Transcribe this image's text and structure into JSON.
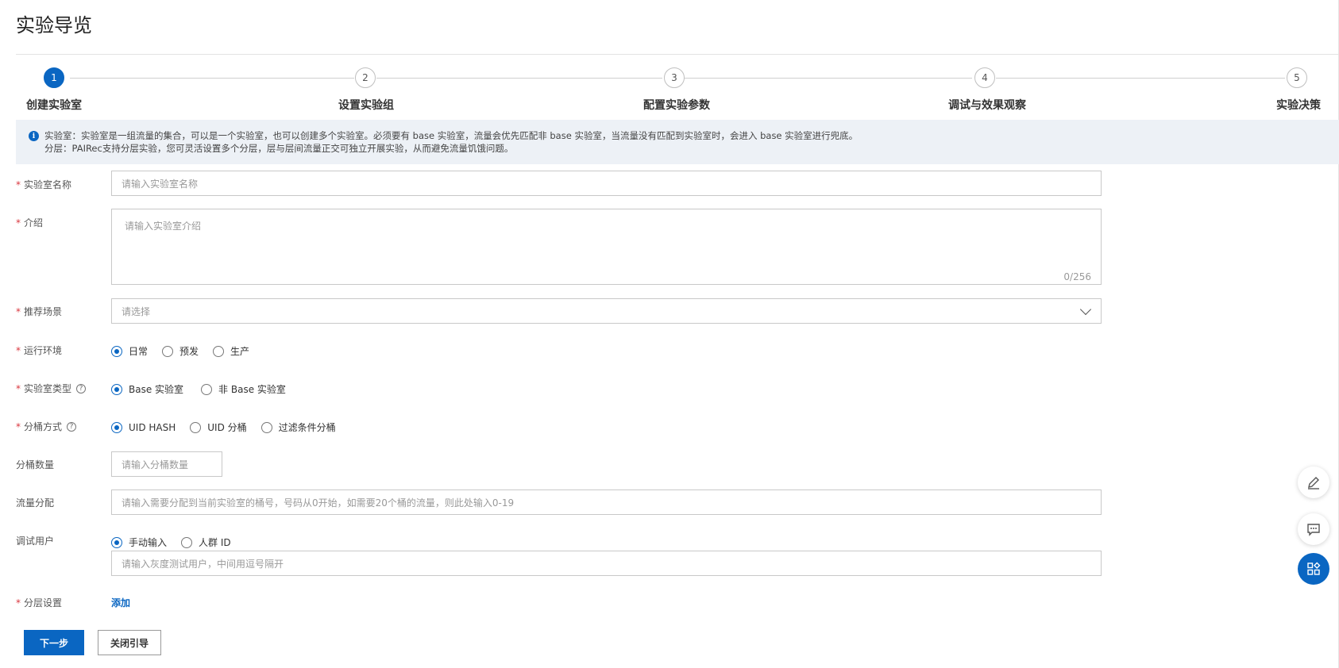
{
  "page": {
    "title": "实验导览"
  },
  "steps": [
    {
      "num": "1",
      "label": "创建实验室",
      "active": true
    },
    {
      "num": "2",
      "label": "设置实验组",
      "active": false
    },
    {
      "num": "3",
      "label": "配置实验参数",
      "active": false
    },
    {
      "num": "4",
      "label": "调试与效果观察",
      "active": false
    },
    {
      "num": "5",
      "label": "实验决策",
      "active": false
    }
  ],
  "notice": {
    "icon": "i",
    "line1": "实验室：实验室是一组流量的集合，可以是一个实验室，也可以创建多个实验室。必须要有 base 实验室，流量会优先匹配非 base 实验室，当流量没有匹配到实验室时，会进入 base 实验室进行兜底。",
    "line2": "分层：PAIRec支持分层实验，您可灵活设置多个分层，层与层间流量正交可独立开展实验，从而避免流量饥饿问题。"
  },
  "form": {
    "required_mark": "*",
    "lab_name": {
      "label": "实验室名称",
      "placeholder": "请输入实验室名称"
    },
    "intro": {
      "label": "介绍",
      "placeholder": "请输入实验室介绍",
      "counter": "0/256"
    },
    "scene": {
      "label": "推荐场景",
      "placeholder": "请选择"
    },
    "env": {
      "label": "运行环境",
      "options": [
        "日常",
        "预发",
        "生产"
      ],
      "selected": 0
    },
    "lab_type": {
      "label": "实验室类型",
      "help": "?",
      "options": [
        "Base 实验室",
        "非 Base 实验室"
      ],
      "selected": 0
    },
    "bucket_method": {
      "label": "分桶方式",
      "help": "?",
      "options": [
        "UID HASH",
        "UID 分桶",
        "过滤条件分桶"
      ],
      "selected": 0
    },
    "bucket_count": {
      "label": "分桶数量",
      "placeholder": "请输入分桶数量"
    },
    "traffic": {
      "label": "流量分配",
      "placeholder": "请输入需要分配到当前实验室的桶号，号码从0开始，如需要20个桶的流量，则此处输入0-19"
    },
    "debug_users": {
      "label": "调试用户",
      "options": [
        "手动输入",
        "人群 ID"
      ],
      "selected": 0,
      "placeholder": "请输入灰度测试用户，中间用逗号隔开"
    },
    "layers": {
      "label": "分层设置",
      "add_label": "添加"
    }
  },
  "actions": {
    "next_label": "下一步",
    "close_label": "关闭引导"
  },
  "floating": [
    "edit-icon",
    "feedback-icon",
    "apps-icon"
  ],
  "colors": {
    "primary": "#0a66c2",
    "required": "#d9363e",
    "notice_bg": "#edf1f6"
  }
}
